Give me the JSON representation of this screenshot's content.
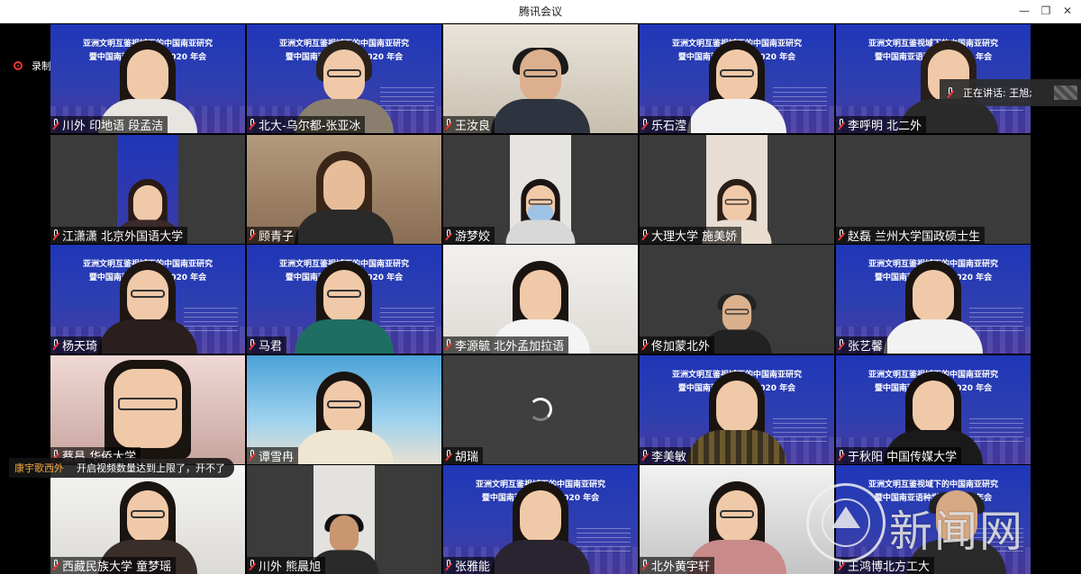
{
  "window": {
    "title": "腾讯会议"
  },
  "recording": {
    "label": "录制中"
  },
  "speaking": {
    "text": "正在讲话: 王旭;"
  },
  "chat": {
    "sender": "康宇歌西外",
    "message": "开启视频数量达到上限了，开不了"
  },
  "watermark": {
    "text": "新闻网"
  },
  "banner": {
    "line1": "亚洲文明互鉴视域下的中国南亚研究",
    "line2": "暨中国南亚语种学会 2020 年会"
  },
  "participants": [
    {
      "name": "川外 印地语 段孟洁"
    },
    {
      "name": "北大-乌尔都-张亚冰"
    },
    {
      "name": "王汝良"
    },
    {
      "name": "乐石滢"
    },
    {
      "name": "李呼明 北二外"
    },
    {
      "name": "江潇潇 北京外国语大学"
    },
    {
      "name": "顾青子"
    },
    {
      "name": "游梦姣"
    },
    {
      "name": "大理大学 施美娇"
    },
    {
      "name": "赵磊 兰州大学国政硕士生"
    },
    {
      "name": "杨天琦"
    },
    {
      "name": "马君"
    },
    {
      "name": "李源毓 北外孟加拉语"
    },
    {
      "name": "佟加蒙北外"
    },
    {
      "name": "张艺馨"
    },
    {
      "name": "蔡昌 华侨大学"
    },
    {
      "name": "谭雪冉"
    },
    {
      "name": "胡瑞"
    },
    {
      "name": "李美敏"
    },
    {
      "name": "于秋阳 中国传媒大学"
    },
    {
      "name": "西藏民族大学 童梦瑶"
    },
    {
      "name": "川外 熊晨旭"
    },
    {
      "name": "张雅能"
    },
    {
      "name": "北外黄宇轩"
    },
    {
      "name": "王鸿博北方工大"
    }
  ]
}
